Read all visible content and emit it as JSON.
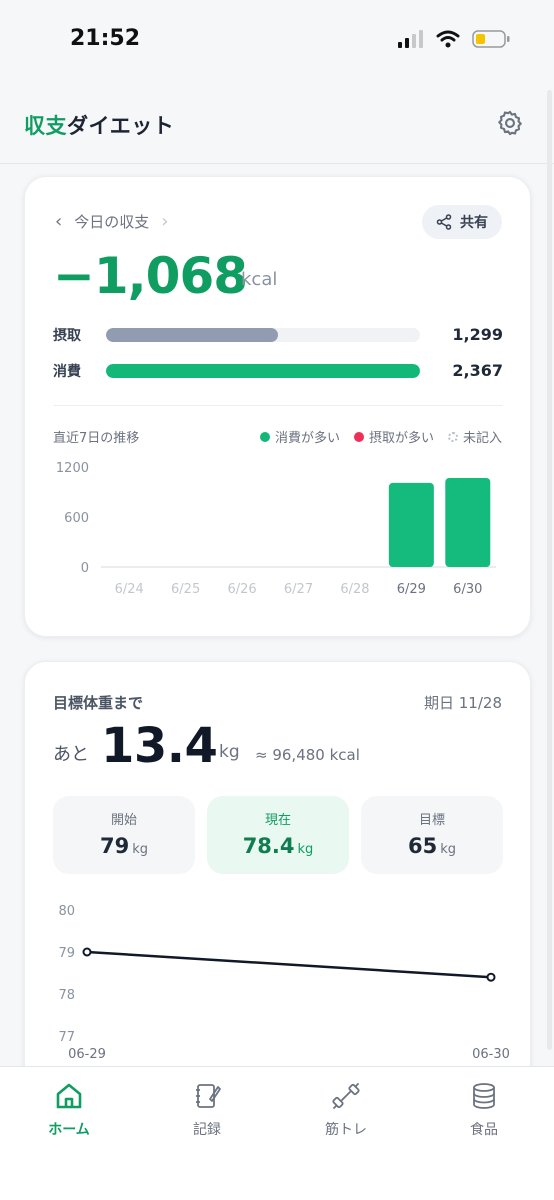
{
  "status": {
    "time": "21:52"
  },
  "header": {
    "title_accent": "収支",
    "title_rest": "ダイエット"
  },
  "balance": {
    "nav_label": "今日の収支",
    "share_label": "共有",
    "value": "−1,068",
    "unit": "kcal",
    "intake": {
      "label": "摂取",
      "value": "1,299",
      "ratio": 0.549
    },
    "burn": {
      "label": "消費",
      "value": "2,367",
      "ratio": 1.0
    },
    "trend_title": "直近7日の推移",
    "legend": {
      "burn_more": "消費が多い",
      "intake_more": "摂取が多い",
      "unrecorded": "未記入"
    }
  },
  "colors": {
    "accent": "#0f9d62",
    "intake_bar": "#919cb3",
    "burn_bar": "#12b877",
    "intake_dot": "#ef2f56",
    "chart_bar": "#14bb7d"
  },
  "chart_data": [
    {
      "type": "bar",
      "categories": [
        "6/24",
        "6/25",
        "6/26",
        "6/27",
        "6/28",
        "6/29",
        "6/30"
      ],
      "values": [
        0,
        0,
        0,
        0,
        0,
        1010,
        1068
      ],
      "yticks": [
        "1200",
        "600",
        "0"
      ],
      "ylim": [
        0,
        1200
      ],
      "grid": false
    },
    {
      "type": "line",
      "x": [
        "06-29",
        "06-30"
      ],
      "values": [
        79,
        78.4
      ],
      "yticks": [
        "80",
        "79",
        "78",
        "77"
      ],
      "ylim": [
        77,
        80
      ]
    }
  ],
  "goal": {
    "title": "目標体重まで",
    "deadline": "期日 11/28",
    "remain_prefix": "あと",
    "remain_value": "13.4",
    "remain_unit": "kg",
    "remain_kcal": "≈ 96,480 kcal",
    "start": {
      "label": "開始",
      "value": "79",
      "unit": "kg"
    },
    "current": {
      "label": "現在",
      "value": "78.4",
      "unit": "kg"
    },
    "target": {
      "label": "目標",
      "value": "65",
      "unit": "kg"
    }
  },
  "tabs": [
    {
      "label": "ホーム",
      "icon": "home-icon",
      "active": true
    },
    {
      "label": "記録",
      "icon": "notebook-icon",
      "active": false
    },
    {
      "label": "筋トレ",
      "icon": "dumbbell-icon",
      "active": false
    },
    {
      "label": "食品",
      "icon": "database-icon",
      "active": false
    }
  ]
}
